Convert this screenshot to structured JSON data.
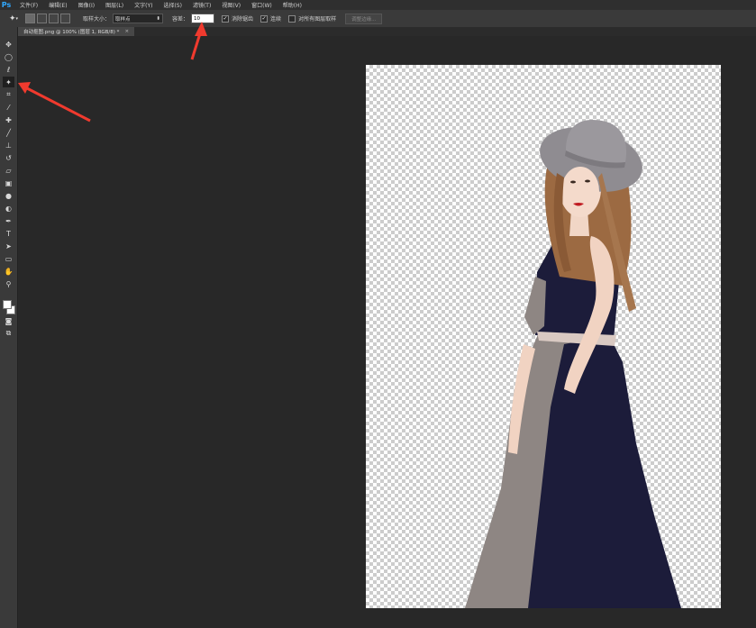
{
  "app": {
    "logo": "Ps"
  },
  "menu": [
    "文件(F)",
    "编辑(E)",
    "图像(I)",
    "图层(L)",
    "文字(Y)",
    "选择(S)",
    "滤镜(T)",
    "视图(V)",
    "窗口(W)",
    "帮助(H)"
  ],
  "options": {
    "sample_size_label": "取样大小：",
    "sample_size_value": "取样点",
    "tolerance_label": "容差：",
    "tolerance_value": "10",
    "antialias_label": "消除锯齿",
    "contiguous_label": "连续",
    "sample_all_label": "对所有图层取样",
    "refine_edge_label": "调整边缘..."
  },
  "document": {
    "tab_title": "自动抠图.png @ 100% (图层 1, RGB/8) *",
    "close": "×"
  },
  "colors": {
    "accent": "#31a8ff",
    "annotation": "#f03a2e",
    "dress_dark": "#1c1c3a",
    "dress_gray": "#8e8683"
  }
}
